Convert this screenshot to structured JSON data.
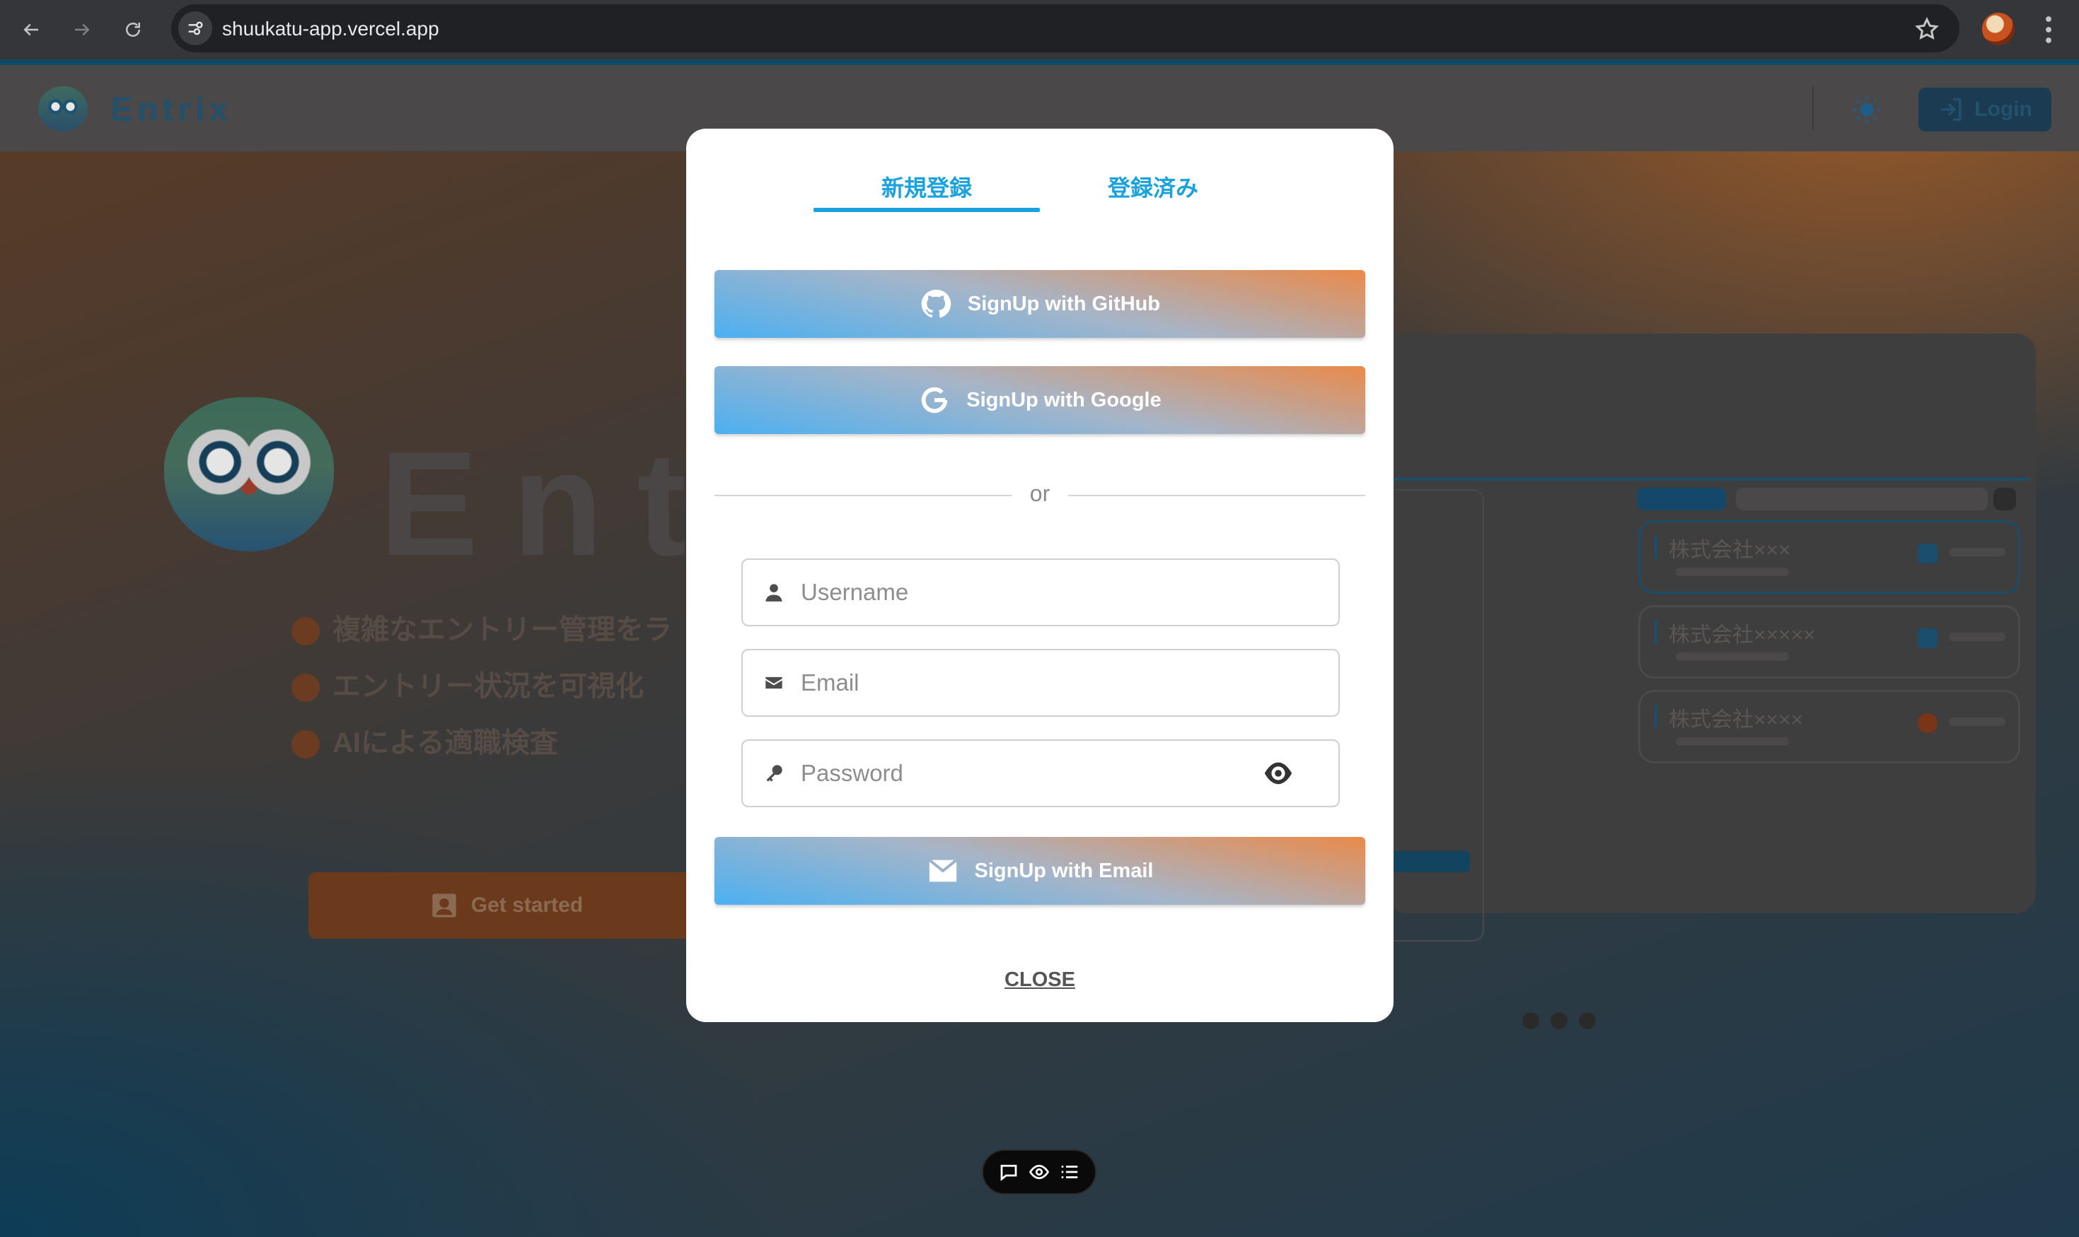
{
  "browser": {
    "url": "shuukatu-app.vercel.app"
  },
  "app": {
    "name": "Entrix",
    "login_label": "Login",
    "hero_title": "Entr",
    "features": [
      "複雑なエントリー管理をラ",
      "エントリー状況を可視化",
      "AIによる適職検査"
    ],
    "get_started_label": "Get started",
    "companies": [
      "株式会社×××",
      "株式会社×××××",
      "株式会社××××"
    ]
  },
  "modal": {
    "tabs": [
      {
        "label": "新規登録",
        "active": true
      },
      {
        "label": "登録済み",
        "active": false
      }
    ],
    "github_button": "SignUp with GitHub",
    "google_button": "SignUp with Google",
    "divider": "or",
    "username_placeholder": "Username",
    "email_placeholder": "Email",
    "password_placeholder": "Password",
    "email_button": "SignUp with Email",
    "close_label": "CLOSE"
  },
  "colors": {
    "accent": "#1aa2e0",
    "gradient_start": "#4cb0f1",
    "gradient_end": "#ea8a4a"
  },
  "icons": {
    "browser": [
      "back-arrow-icon",
      "forward-arrow-icon",
      "reload-icon",
      "site-info-icon",
      "star-icon",
      "kebab-menu-icon"
    ],
    "modal": [
      "github-icon",
      "google-icon",
      "user-icon",
      "envelope-icon",
      "key-icon",
      "eye-icon",
      "mail-icon"
    ],
    "toolbar": [
      "comment-icon",
      "eye-outline-icon",
      "list-icon"
    ]
  }
}
